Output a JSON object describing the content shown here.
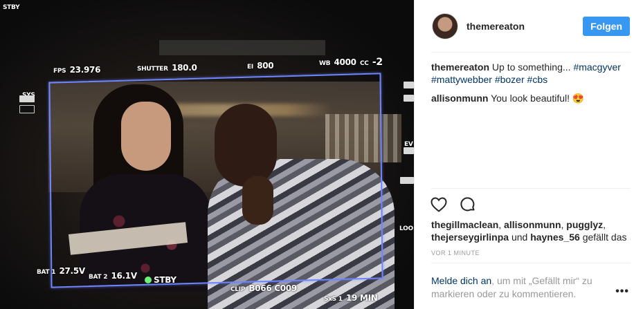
{
  "hud": {
    "stby_top": "STBY",
    "fps_label": "FPS",
    "fps_value": "23.976",
    "shutter_label": "SHUTTER",
    "shutter_value": "180.0",
    "ei_label": "EI",
    "ei_value": "800",
    "wb_label": "WB",
    "wb_value": "4000",
    "cc_label": "CC",
    "cc_value": "-2",
    "sys_label": "SYS",
    "bat1_label": "BAT 1",
    "bat1_value": "27.5V",
    "bat2_label": "BAT 2",
    "bat2_value": "16.1V",
    "stby_label": "STBY",
    "clip_label": "CLIP",
    "clip_value": "B066 C009",
    "sxs_label": "SxS 1",
    "sxs_value": "19 MIN",
    "right_ev": "EV",
    "right_loo": "LOO"
  },
  "post": {
    "username": "themereaton",
    "follow_label": "Folgen",
    "caption": {
      "user": "themereaton",
      "text": "Up to something...",
      "tags": [
        "#macgyver",
        "#mattywebber",
        "#bozer",
        "#cbs"
      ]
    },
    "comment": {
      "user": "allisonmunn",
      "text": "You look beautiful! 😍"
    },
    "likes": {
      "users": [
        "thegillmaclean",
        "allisonmunn",
        "pugglyz",
        "thejerseygirlinpa"
      ],
      "and_text": "und",
      "last_user": "haynes_56",
      "suffix": "gefällt das"
    },
    "time": "VOR 1 MINUTE",
    "login": {
      "link": "Melde dich an",
      "text": ", um mit „Gefällt mir“ zu markieren oder zu kommentieren."
    },
    "more": "•••"
  },
  "icons": {
    "like": "heart-icon",
    "comment": "comment-bubble-icon",
    "more": "more-options-icon"
  },
  "colors": {
    "follow_button": "#3897f0",
    "link": "#003569",
    "frame_line": "#6f86ff",
    "standby_indicator": "#6df07a"
  }
}
